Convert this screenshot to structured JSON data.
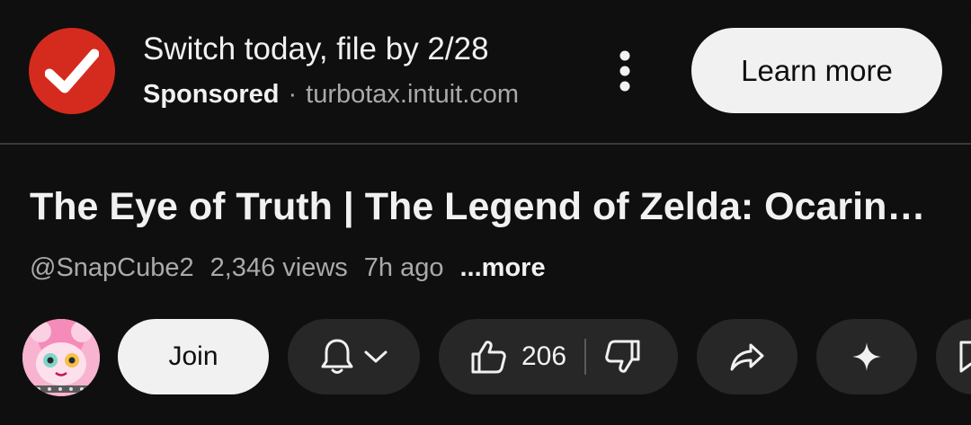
{
  "ad": {
    "title": "Switch today, file by 2/28",
    "sponsored_label": "Sponsored",
    "separator": "·",
    "domain": "turbotax.intuit.com",
    "cta_label": "Learn more",
    "logo_icon": "checkmark-icon",
    "brand_color": "#d52b1e"
  },
  "video": {
    "title": "The Eye of Truth | The Legend of Zelda: Ocarina of Time",
    "channel_handle": "@SnapCube2",
    "views": "2,346 views",
    "age": "7h ago",
    "more_label": "...more"
  },
  "actions": {
    "join_label": "Join",
    "like_count": "206",
    "icons": [
      "bell-icon",
      "chevron-down-icon",
      "thumbs-up-icon",
      "thumbs-down-icon",
      "share-icon",
      "sparkle-icon",
      "save-icon"
    ]
  },
  "colors": {
    "background": "#0f0f0f",
    "pill": "#272727",
    "primary_text": "#f1f1f1",
    "secondary_text": "#aaaaaa"
  }
}
